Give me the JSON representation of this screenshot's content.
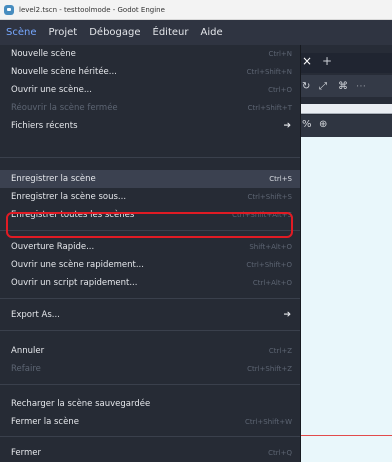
{
  "window": {
    "title": "level2.tscn - testtoolmode - Godot Engine"
  },
  "menubar": [
    "Scène",
    "Projet",
    "Débogage",
    "Éditeur",
    "Aide"
  ],
  "editor": {
    "tab_close": "×",
    "tab_add": "+"
  },
  "menu": {
    "items": [
      {
        "label": "Nouvelle scène",
        "shortcut": "Ctrl+N"
      },
      {
        "label": "Nouvelle scène héritée...",
        "shortcut": "Ctrl+Shift+N"
      },
      {
        "label": "Ouvrir une scène...",
        "shortcut": "Ctrl+O"
      },
      {
        "label": "Réouvrir la scène fermée",
        "shortcut": "Ctrl+Shift+T"
      },
      {
        "label": "Fichiers récents",
        "arrow": "➔"
      },
      {
        "label": "Enregistrer la scène",
        "shortcut": "Ctrl+S"
      },
      {
        "label": "Enregistrer la scène sous...",
        "shortcut": "Ctrl+Shift+S"
      },
      {
        "label": "Enregistrer toutes les scènes",
        "shortcut": "Ctrl+Shift+Alt+S"
      },
      {
        "label": "Ouverture Rapide...",
        "shortcut": "Shift+Alt+O"
      },
      {
        "label": "Ouvrir une scène rapidement...",
        "shortcut": "Ctrl+Shift+O"
      },
      {
        "label": "Ouvrir un script rapidement...",
        "shortcut": "Ctrl+Alt+O"
      },
      {
        "label": "Export As...",
        "arrow": "➔"
      },
      {
        "label": "Annuler",
        "shortcut": "Ctrl+Z"
      },
      {
        "label": "Refaire",
        "shortcut": "Ctrl+Shift+Z"
      },
      {
        "label": "Recharger la scène sauvegardée"
      },
      {
        "label": "Fermer la scène",
        "shortcut": "Ctrl+Shift+W"
      },
      {
        "label": "Fermer",
        "shortcut": "Ctrl+Q"
      }
    ]
  }
}
